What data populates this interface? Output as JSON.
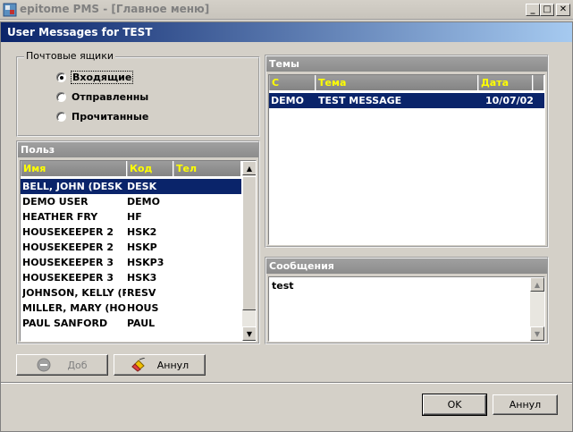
{
  "outer_window": {
    "title": "epitome PMS - [Главное меню]",
    "min_icon": "minimize-icon",
    "max_icon": "maximize-icon",
    "close_icon": "close-icon"
  },
  "dialog": {
    "title": "User Messages for TEST"
  },
  "mailboxes": {
    "legend": "Почтовые ящики",
    "options": [
      {
        "label": "Входящие",
        "selected": true
      },
      {
        "label": "Отправленны",
        "selected": false
      },
      {
        "label": "Прочитанные",
        "selected": false
      }
    ]
  },
  "users": {
    "header": "Польз",
    "columns": [
      "Имя",
      "Код",
      "Тел"
    ],
    "rows": [
      {
        "name": "BELL, JOHN (DESK CL",
        "code": "DESK",
        "tel": "",
        "selected": true
      },
      {
        "name": "DEMO USER",
        "code": "DEMO",
        "tel": ""
      },
      {
        "name": "HEATHER FRY",
        "code": "HF",
        "tel": ""
      },
      {
        "name": "HOUSEKEEPER 2",
        "code": "HSK2",
        "tel": ""
      },
      {
        "name": "HOUSEKEEPER 2",
        "code": "HSKP",
        "tel": ""
      },
      {
        "name": "HOUSEKEEPER 3",
        "code": "HSKP3",
        "tel": ""
      },
      {
        "name": "HOUSEKEEPER 3",
        "code": "HSK3",
        "tel": ""
      },
      {
        "name": "JOHNSON, KELLY (RES",
        "code": "RESV",
        "tel": ""
      },
      {
        "name": "MILLER, MARY (HOUS",
        "code": "HOUS",
        "tel": ""
      },
      {
        "name": "PAUL SANFORD",
        "code": "PAUL",
        "tel": ""
      }
    ]
  },
  "topics": {
    "header": "Темы",
    "columns": [
      "С",
      "Тема",
      "Дата"
    ],
    "rows": [
      {
        "from": "DEMO",
        "subject": "TEST MESSAGE",
        "date": "10/07/02",
        "selected": true
      }
    ]
  },
  "messages": {
    "header": "Сообщения",
    "text": "test"
  },
  "buttons": {
    "add_label": "Доб",
    "add_icon": "no-entry-icon",
    "cancel_small_label": "Аннул",
    "cancel_small_icon": "eraser-icon",
    "ok_label": "OK",
    "cancel_label": "Аннул"
  },
  "colors": {
    "selection": "#0a246a",
    "grid_header_text": "#ffff00",
    "title_gradient_start": "#0a246a",
    "title_gradient_end": "#a6caf0"
  }
}
